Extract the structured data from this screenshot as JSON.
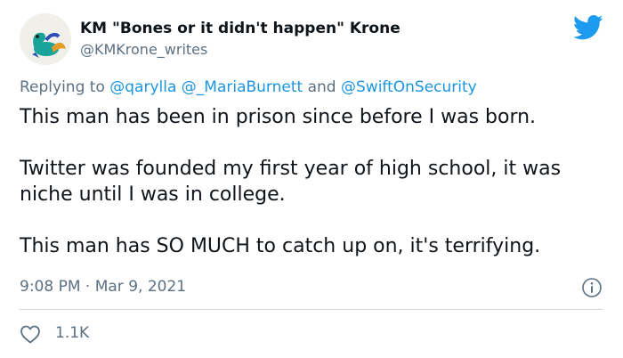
{
  "author": {
    "display_name": "KM \"Bones or it didn't happen\" Krone",
    "handle": "@KMKrone_writes",
    "avatar_icon": "dinosaur-toy-avatar"
  },
  "reply": {
    "prefix": "Replying to ",
    "mention_1": "@qarylla",
    "mention_2": "@_MariaBurnett",
    "conjunction": " and ",
    "mention_3": "@SwiftOnSecurity"
  },
  "tweet": {
    "paragraphs": [
      "This man has been in prison since before I was born.",
      "Twitter was founded my first year of high school, it was niche until I was in college.",
      "This man has SO MUCH to catch up on, it's terrifying."
    ],
    "time": "9:08 PM",
    "separator": " · ",
    "date": "Mar 9, 2021"
  },
  "engagement": {
    "likes": "1.1K"
  },
  "icons": {
    "brand": "twitter-bird-icon",
    "info": "info-icon",
    "like": "heart-icon"
  },
  "colors": {
    "brand_blue": "#1d9bf0",
    "mention_blue": "#1b95e0",
    "secondary_text": "#5b7083",
    "primary_text": "#0f1419"
  }
}
